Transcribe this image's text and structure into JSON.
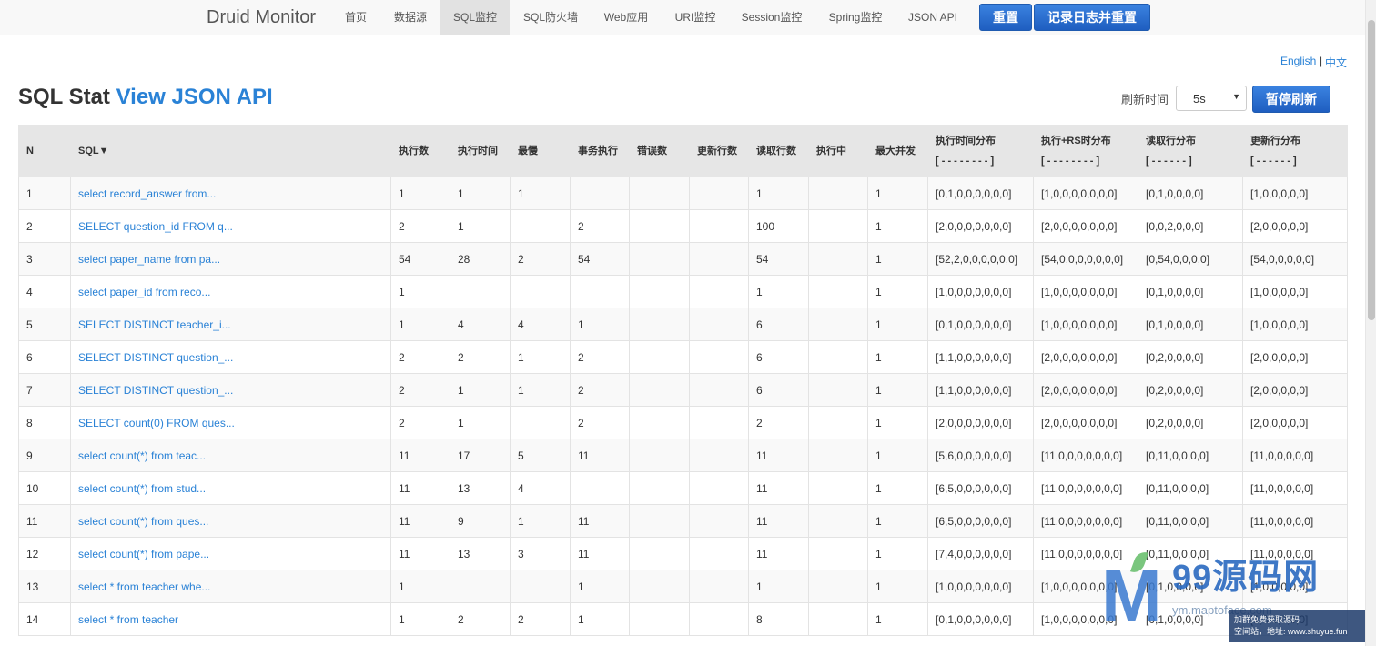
{
  "navbar": {
    "brand": "Druid Monitor",
    "items": [
      {
        "label": "首页",
        "active": false
      },
      {
        "label": "数据源",
        "active": false
      },
      {
        "label": "SQL监控",
        "active": true
      },
      {
        "label": "SQL防火墙",
        "active": false
      },
      {
        "label": "Web应用",
        "active": false
      },
      {
        "label": "URI监控",
        "active": false
      },
      {
        "label": "Session监控",
        "active": false
      },
      {
        "label": "Spring监控",
        "active": false
      },
      {
        "label": "JSON API",
        "active": false
      }
    ],
    "reset_label": "重置",
    "log_reset_label": "记录日志并重置"
  },
  "lang": {
    "english": "English",
    "sep": "|",
    "chinese": "中文"
  },
  "heading": {
    "title": "SQL Stat",
    "link": "View JSON API",
    "refresh_label": "刷新时间",
    "refresh_value": "5s",
    "pause_label": "暂停刷新"
  },
  "table": {
    "headers": [
      {
        "line1": "N",
        "line2": ""
      },
      {
        "line1": "SQL▼",
        "line2": ""
      },
      {
        "line1": "执行数",
        "line2": ""
      },
      {
        "line1": "执行时间",
        "line2": ""
      },
      {
        "line1": "最慢",
        "line2": ""
      },
      {
        "line1": "事务执行",
        "line2": ""
      },
      {
        "line1": "错误数",
        "line2": ""
      },
      {
        "line1": "更新行数",
        "line2": ""
      },
      {
        "line1": "读取行数",
        "line2": ""
      },
      {
        "line1": "执行中",
        "line2": ""
      },
      {
        "line1": "最大并发",
        "line2": ""
      },
      {
        "line1": "执行时间分布",
        "line2": "[ - - - - - - - - ]"
      },
      {
        "line1": "执行+RS时分布",
        "line2": "[ - - - - - - - - ]"
      },
      {
        "line1": "读取行分布",
        "line2": "[ - - - - - - ]"
      },
      {
        "line1": "更新行分布",
        "line2": "[ - - - - - - ]"
      }
    ],
    "rows": [
      [
        "1",
        "select record_answer from...",
        "1",
        "1",
        "1",
        "",
        "",
        "",
        "1",
        "",
        "1",
        "[0,1,0,0,0,0,0,0]",
        "[1,0,0,0,0,0,0,0]",
        "[0,1,0,0,0,0]",
        "[1,0,0,0,0,0]"
      ],
      [
        "2",
        "SELECT question_id FROM q...",
        "2",
        "1",
        "",
        "2",
        "",
        "",
        "100",
        "",
        "1",
        "[2,0,0,0,0,0,0,0]",
        "[2,0,0,0,0,0,0,0]",
        "[0,0,2,0,0,0]",
        "[2,0,0,0,0,0]"
      ],
      [
        "3",
        "select paper_name from pa...",
        "54",
        "28",
        "2",
        "54",
        "",
        "",
        "54",
        "",
        "1",
        "[52,2,0,0,0,0,0,0]",
        "[54,0,0,0,0,0,0,0]",
        "[0,54,0,0,0,0]",
        "[54,0,0,0,0,0]"
      ],
      [
        "4",
        "select paper_id from reco...",
        "1",
        "",
        "",
        "",
        "",
        "",
        "1",
        "",
        "1",
        "[1,0,0,0,0,0,0,0]",
        "[1,0,0,0,0,0,0,0]",
        "[0,1,0,0,0,0]",
        "[1,0,0,0,0,0]"
      ],
      [
        "5",
        "SELECT DISTINCT teacher_i...",
        "1",
        "4",
        "4",
        "1",
        "",
        "",
        "6",
        "",
        "1",
        "[0,1,0,0,0,0,0,0]",
        "[1,0,0,0,0,0,0,0]",
        "[0,1,0,0,0,0]",
        "[1,0,0,0,0,0]"
      ],
      [
        "6",
        "SELECT DISTINCT question_...",
        "2",
        "2",
        "1",
        "2",
        "",
        "",
        "6",
        "",
        "1",
        "[1,1,0,0,0,0,0,0]",
        "[2,0,0,0,0,0,0,0]",
        "[0,2,0,0,0,0]",
        "[2,0,0,0,0,0]"
      ],
      [
        "7",
        "SELECT DISTINCT question_...",
        "2",
        "1",
        "1",
        "2",
        "",
        "",
        "6",
        "",
        "1",
        "[1,1,0,0,0,0,0,0]",
        "[2,0,0,0,0,0,0,0]",
        "[0,2,0,0,0,0]",
        "[2,0,0,0,0,0]"
      ],
      [
        "8",
        "SELECT count(0) FROM ques...",
        "2",
        "1",
        "",
        "2",
        "",
        "",
        "2",
        "",
        "1",
        "[2,0,0,0,0,0,0,0]",
        "[2,0,0,0,0,0,0,0]",
        "[0,2,0,0,0,0]",
        "[2,0,0,0,0,0]"
      ],
      [
        "9",
        "select count(*) from teac...",
        "11",
        "17",
        "5",
        "11",
        "",
        "",
        "11",
        "",
        "1",
        "[5,6,0,0,0,0,0,0]",
        "[11,0,0,0,0,0,0,0]",
        "[0,11,0,0,0,0]",
        "[11,0,0,0,0,0]"
      ],
      [
        "10",
        "select count(*) from stud...",
        "11",
        "13",
        "4",
        "",
        "",
        "",
        "11",
        "",
        "1",
        "[6,5,0,0,0,0,0,0]",
        "[11,0,0,0,0,0,0,0]",
        "[0,11,0,0,0,0]",
        "[11,0,0,0,0,0]"
      ],
      [
        "11",
        "select count(*) from ques...",
        "11",
        "9",
        "1",
        "11",
        "",
        "",
        "11",
        "",
        "1",
        "[6,5,0,0,0,0,0,0]",
        "[11,0,0,0,0,0,0,0]",
        "[0,11,0,0,0,0]",
        "[11,0,0,0,0,0]"
      ],
      [
        "12",
        "select count(*) from pape...",
        "11",
        "13",
        "3",
        "11",
        "",
        "",
        "11",
        "",
        "1",
        "[7,4,0,0,0,0,0,0]",
        "[11,0,0,0,0,0,0,0]",
        "[0,11,0,0,0,0]",
        "[11,0,0,0,0,0]"
      ],
      [
        "13",
        "select * from teacher whe...",
        "1",
        "",
        "",
        "1",
        "",
        "",
        "1",
        "",
        "1",
        "[1,0,0,0,0,0,0,0]",
        "[1,0,0,0,0,0,0,0]",
        "[0,1,0,0,0,0]",
        "[1,0,0,0,0,0]"
      ],
      [
        "14",
        "select * from teacher",
        "1",
        "2",
        "2",
        "1",
        "",
        "",
        "8",
        "",
        "1",
        "[0,1,0,0,0,0,0,0]",
        "[1,0,0,0,0,0,0,0]",
        "[0,1,0,0,0,0]",
        "[1,0,0,0,0,0]"
      ]
    ]
  },
  "watermark": {
    "logo": "M",
    "text": "99源码网",
    "url": "ym.maptoface.com",
    "box_line1": "加群免费获取源码",
    "box_line2": "空间站，地址: www.shuyue.fun"
  },
  "colors": {
    "accent": "#2a82d6",
    "button": "#2b6fd0",
    "header_bg": "#e6e6e6"
  }
}
